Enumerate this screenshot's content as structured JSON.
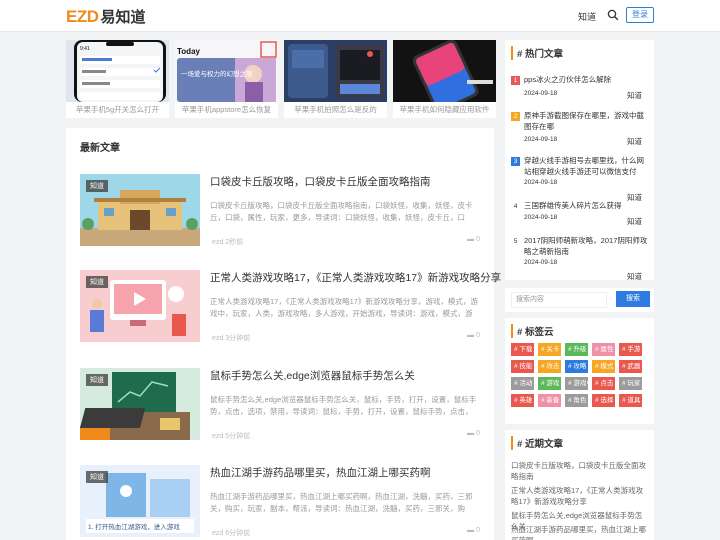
{
  "header": {
    "logo_mark": "EZD",
    "logo_text": "易知道",
    "nav_link": "知道",
    "login": "登录"
  },
  "carousel": [
    {
      "caption": "苹果手机5g开关怎么打开"
    },
    {
      "caption": "苹果手机appstore怎么恢复"
    },
    {
      "caption": "苹果手机拍照怎么是反的"
    },
    {
      "caption": "苹果手机如何隐藏应用软件"
    }
  ],
  "carousel_text": {
    "phone_time": "9:41",
    "today": "Today",
    "banner": "一场爱与权力的幻想之旅"
  },
  "main": {
    "section_title": "最新文章",
    "articles": [
      {
        "tag": "知道",
        "title": "口袋皮卡丘版攻略，口袋皮卡丘版全面攻略指南",
        "desc": "口袋皮卡丘版攻略，口袋皮卡丘版全面攻略指南，口袋妖怪，收集，妖怪，皮卡丘，口袋，属性，玩家，更多，导读词：口袋妖怪，收集，妖怪，皮卡丘，口袋，属性，玩",
        "author": "ezd",
        "time": "2秒前",
        "comments": "0"
      },
      {
        "tag": "知道",
        "title": "正常人类游戏攻略17，《正常人类游戏攻略17》新游戏攻略分享",
        "desc": "正常人类游戏攻略17，《正常人类游戏攻略17》新游戏攻略分享，游戏，模式，游戏中，玩家，人类，游戏攻略，多人游戏，开始游戏，导读词：游戏，模式，游戏中，玩",
        "author": "ezd",
        "time": "3分钟前",
        "comments": "0"
      },
      {
        "tag": "知道",
        "title": "鼠标手势怎么关,edge浏览器鼠标手势怎么关",
        "desc": "鼠标手势怎么关,edge浏览器鼠标手势怎么关，鼠标，手势，打开，设置，鼠标手势，点击，选项，禁用，导读词：鼠标，手势，打开，设置，鼠标手势，点击，选项，禁用",
        "author": "ezd",
        "time": "5分钟前",
        "comments": "0"
      },
      {
        "tag": "知道",
        "title": "热血江湖手游药品哪里买，热血江湖上哪买药啊",
        "desc": "热血江湖手游药品哪里买，热血江湖上哪买药啊，热血江湖，洗髓，买药，三邪关，购买，玩家，副本，帮派，导读词：热血江湖，洗髓，买药，三邪关，购买，玩家，副",
        "author": "ezd",
        "time": "6分钟前",
        "comments": "0",
        "thumb_caption": "1. 打开热血江湖游戏，进入游戏"
      }
    ]
  },
  "sidebar": {
    "hot": {
      "title": "热门文章",
      "items": [
        {
          "num": "1",
          "text": "pps冰火之刃伙伴怎么解除",
          "date": "2024-09-18",
          "cat": "知道",
          "color": "#e85a5a"
        },
        {
          "num": "2",
          "text": "原神手游截图保存在哪里，游戏中截图存在哪",
          "date": "2024-09-18",
          "cat": "知道",
          "color": "#f5a623"
        },
        {
          "num": "3",
          "text": "穿越火线手游相号去哪里找，什么网站相穿越火线手游还可以微信支付",
          "date": "2024-09-18",
          "cat": "知道",
          "color": "#2d7be0"
        },
        {
          "num": "4",
          "text": "三国群雄传美人碎片怎么获得",
          "date": "2024-09-18",
          "cat": "知道",
          "color": "#ffffff"
        },
        {
          "num": "5",
          "text": "2017阴阳师萌新攻略，2017阴阳师攻略之萌新指南",
          "date": "2024-09-18",
          "cat": "知道",
          "color": "#ffffff"
        }
      ]
    },
    "search": {
      "placeholder": "搜索内容",
      "button": "搜索"
    },
    "tags": {
      "title": "标签云",
      "items": [
        {
          "t": "# 下载",
          "c": "#e8584e"
        },
        {
          "t": "# 关卡",
          "c": "#f5a623"
        },
        {
          "t": "# 升级",
          "c": "#5cb85c"
        },
        {
          "t": "# 属性",
          "c": "#ef8fa8"
        },
        {
          "t": "# 手游",
          "c": "#e8584e"
        },
        {
          "t": "# 技能",
          "c": "#e8584e"
        },
        {
          "t": "# 攻击",
          "c": "#f5a623"
        },
        {
          "t": "# 攻略",
          "c": "#2d7be0"
        },
        {
          "t": "# 模式",
          "c": "#f5a623"
        },
        {
          "t": "# 武器",
          "c": "#e8584e"
        },
        {
          "t": "# 活动",
          "c": "#9b9b9b"
        },
        {
          "t": "# 游戏",
          "c": "#5cb85c"
        },
        {
          "t": "# 游戏中",
          "c": "#9b9b9b"
        },
        {
          "t": "# 点击",
          "c": "#e8584e"
        },
        {
          "t": "# 玩家",
          "c": "#9b9b9b"
        },
        {
          "t": "# 英雄",
          "c": "#e8584e"
        },
        {
          "t": "# 装备",
          "c": "#ef8fa8"
        },
        {
          "t": "# 角色",
          "c": "#9b9b9b"
        },
        {
          "t": "# 选择",
          "c": "#e8584e"
        },
        {
          "t": "# 道具",
          "c": "#e8584e"
        }
      ]
    },
    "recent": {
      "title": "近期文章",
      "items": [
        "口袋皮卡丘版攻略，口袋皮卡丘版全面攻略指南",
        "正常人类游戏攻略17，《正常人类游戏攻略17》新游戏攻略分享",
        "鼠标手势怎么关,edge浏览器鼠标手势怎么关",
        "热血江湖手游药品哪里买，热血江湖上哪买药啊"
      ]
    }
  },
  "colors": {
    "accent": "#f08a1c",
    "primary": "#2d7be0"
  }
}
